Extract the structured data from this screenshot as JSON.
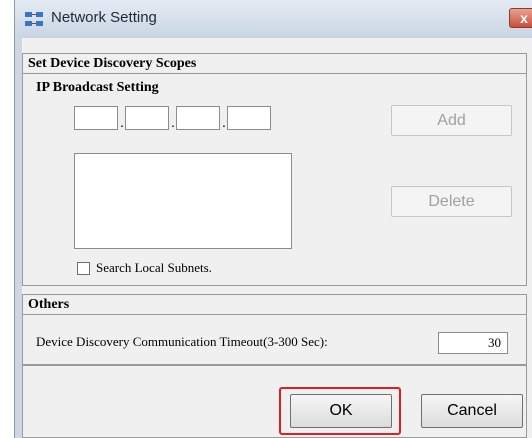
{
  "window": {
    "title": "Network Setting",
    "close_glyph": "x",
    "icon": "network-setting-icon"
  },
  "discovery": {
    "header": "Set Device Discovery Scopes",
    "ip_broadcast_label": "IP Broadcast Setting",
    "ip_octets": [
      "",
      "",
      "",
      ""
    ],
    "ip_separator": ".",
    "add_label": "Add",
    "delete_label": "Delete",
    "search_local_label": "Search Local Subnets.",
    "search_local_checked": false
  },
  "others": {
    "header": "Others",
    "timeout_label": "Device Discovery Communication Timeout(3-300 Sec):",
    "timeout_value": "30"
  },
  "footer": {
    "ok_label": "OK",
    "cancel_label": "Cancel"
  },
  "colors": {
    "highlight": "#e02020",
    "title_bar": "#c9d5e3",
    "close_button": "#c7503a"
  }
}
